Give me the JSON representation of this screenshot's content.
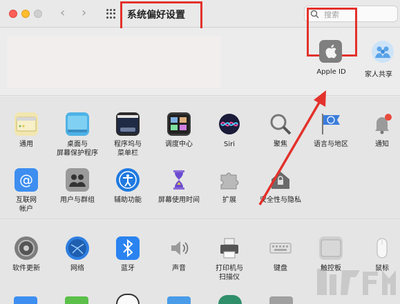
{
  "window": {
    "title": "系统偏好设置",
    "search_placeholder": "搜索"
  },
  "account": {
    "apple_id_label": "Apple ID",
    "family_label": "家人共享"
  },
  "row1": [
    {
      "label": "通用",
      "icon": "general-icon",
      "color": "#f2e6b0"
    },
    {
      "label": "桌面与\n屏幕保护程序",
      "icon": "desktop-screensaver-icon",
      "color": "#4fb2e6"
    },
    {
      "label": "程序坞与\n菜单栏",
      "icon": "dock-menubar-icon",
      "color": "#2b2b2b"
    },
    {
      "label": "调度中心",
      "icon": "mission-control-icon",
      "color": "#3a3a3a"
    },
    {
      "label": "Siri",
      "icon": "siri-icon",
      "color": "#6b2bd6"
    },
    {
      "label": "聚焦",
      "icon": "spotlight-icon",
      "color": "#c9c9c9"
    },
    {
      "label": "语言与地区",
      "icon": "language-region-icon",
      "color": "#3b7ddc"
    },
    {
      "label": "通知",
      "icon": "notifications-icon",
      "color": "#d8d8d8"
    }
  ],
  "row2": [
    {
      "label": "互联网\n帐户",
      "icon": "internet-accounts-icon",
      "color": "#3d8ef0"
    },
    {
      "label": "用户与群组",
      "icon": "users-groups-icon",
      "color": "#9a9a9a"
    },
    {
      "label": "辅助功能",
      "icon": "accessibility-icon",
      "color": "#1f7ae0"
    },
    {
      "label": "屏幕使用时间",
      "icon": "screen-time-icon",
      "color": "#6a4bd0"
    },
    {
      "label": "扩展",
      "icon": "extensions-icon",
      "color": "#b9b9b9"
    },
    {
      "label": "安全性与隐私",
      "icon": "security-privacy-icon",
      "color": "#6a6a6a"
    }
  ],
  "row3": [
    {
      "label": "软件更新",
      "icon": "software-update-icon",
      "color": "#7d7d7d"
    },
    {
      "label": "网络",
      "icon": "network-icon",
      "color": "#2e7fe0"
    },
    {
      "label": "蓝牙",
      "icon": "bluetooth-icon",
      "color": "#2a83f0"
    },
    {
      "label": "声音",
      "icon": "sound-icon",
      "color": "#a5a5a5"
    },
    {
      "label": "打印机与\n扫描仪",
      "icon": "printers-scanners-icon",
      "color": "#5a5a5a"
    },
    {
      "label": "键盘",
      "icon": "keyboard-icon",
      "color": "#d6d6d6"
    },
    {
      "label": "触控板",
      "icon": "trackpad-icon",
      "color": "#cfcfcf"
    },
    {
      "label": "鼠标",
      "icon": "mouse-icon",
      "color": "#f3f3f3"
    }
  ],
  "accent": {
    "highlight": "#e3312b"
  }
}
